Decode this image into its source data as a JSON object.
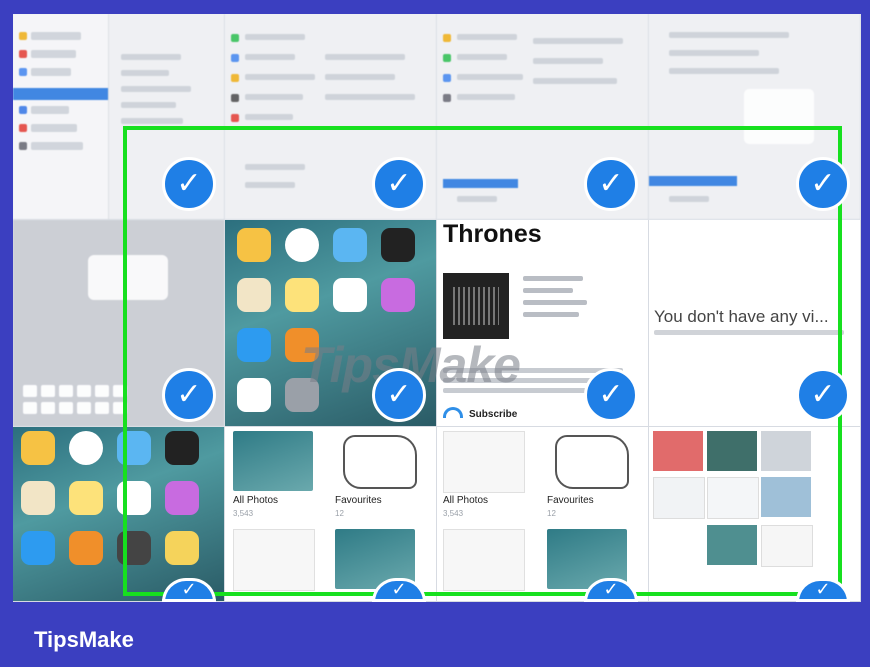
{
  "thrones_title": "Thrones",
  "subscribe_label": "Subscribe",
  "empty_message": "You don't have any vi...",
  "albums": [
    {
      "name": "All Photos",
      "count": "3,543"
    },
    {
      "name": "Favourites",
      "count": "12"
    }
  ],
  "watermark": "TipsMake",
  "footer_brand": "TipsMake",
  "check_glyph": "✓",
  "colors": {
    "page_background": "#3b3fc0",
    "selection_border": "#17e01f",
    "check_fill": "#1f7fe6"
  },
  "icons": [
    "check-icon"
  ]
}
